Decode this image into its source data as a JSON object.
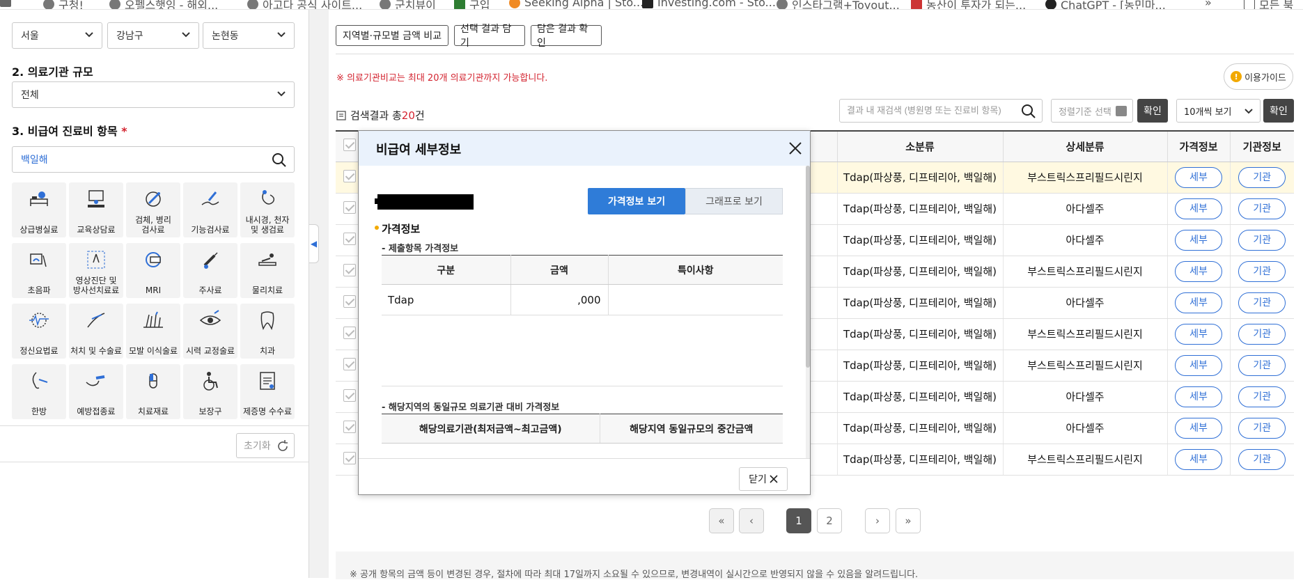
{
  "bookmarks": [
    {
      "label": "구청!",
      "icon": "globe-icon"
    },
    {
      "label": "오펠스햇잉 - 해외...",
      "icon": "globe-icon"
    },
    {
      "label": "아고다 공식 사이트...",
      "icon": "globe-icon"
    },
    {
      "label": "군치뷰이",
      "icon": "globe-icon"
    },
    {
      "label": "구입",
      "icon": "user-icon"
    },
    {
      "label": "Seeking Alpha | Sto...",
      "icon": "alpha-icon"
    },
    {
      "label": "Investing.com - Sto...",
      "icon": "inv-icon"
    },
    {
      "label": "인스타그램+Toyout...",
      "icon": "globe-icon"
    },
    {
      "label": "농산이 투자가 되는...",
      "icon": "doc-icon"
    },
    {
      "label": "ChatGPT - [농민마...",
      "icon": "chatgpt-icon"
    },
    {
      "label": "»",
      "icon": ""
    },
    {
      "label": "모든 북",
      "icon": "folder-icon"
    }
  ],
  "filters": {
    "region1": "서울",
    "region2": "강남구",
    "region3": "논현동",
    "size_title": "2. 의료기관 규모",
    "size_value": "전체",
    "item_title": "3. 비급여 진료비 항목",
    "item_required": "*",
    "search_placeholder": "백일해",
    "reset_label": "초기화"
  },
  "categories": [
    {
      "label": "상급병실료",
      "icon": "hospital-bed-icon"
    },
    {
      "label": "교육상담료",
      "icon": "counseling-icon"
    },
    {
      "label": "검체, 병리\n검사료",
      "icon": "microscope-icon"
    },
    {
      "label": "기능검사료",
      "icon": "function-test-icon"
    },
    {
      "label": "내시경, 천자\n및 생검료",
      "icon": "endoscope-icon"
    },
    {
      "label": "초음파",
      "icon": "ultrasound-icon"
    },
    {
      "label": "영상진단 및\n방사선치료료",
      "icon": "radiation-icon"
    },
    {
      "label": "MRI",
      "icon": "mri-icon"
    },
    {
      "label": "주사료",
      "icon": "syringe-icon"
    },
    {
      "label": "물리치료",
      "icon": "physical-therapy-icon"
    },
    {
      "label": "정신요법료",
      "icon": "brain-icon"
    },
    {
      "label": "처치 및 수술료",
      "icon": "surgery-icon"
    },
    {
      "label": "모발 이식술료",
      "icon": "hair-icon"
    },
    {
      "label": "시력 교정술료",
      "icon": "eye-icon"
    },
    {
      "label": "치과",
      "icon": "tooth-icon"
    },
    {
      "label": "한방",
      "icon": "acupuncture-icon"
    },
    {
      "label": "예방접종료",
      "icon": "vaccine-icon"
    },
    {
      "label": "치료재료",
      "icon": "capsule-icon"
    },
    {
      "label": "보장구",
      "icon": "wheelchair-icon"
    },
    {
      "label": "제증명 수수료",
      "icon": "certificate-icon"
    }
  ],
  "main": {
    "btn_compare": "지역별·규모별 금액 비교",
    "btn_save": "선택 결과 담기",
    "btn_check": "담은 결과 확인",
    "notice": "※ 의료기관비교는 최대 20개 의료기관까지 가능합니다.",
    "guide": "이용가이드",
    "result_prefix": "검색결과 총",
    "result_count": "20",
    "result_suffix": "건",
    "re_search_placeholder": "결과 내 재검색 (병원명 또는 진료비 항목)",
    "sort_label": "정렬기준 선택",
    "confirm": "확인",
    "per_page": "10개씩 보기",
    "footer_note": "※ 공개 항목의 금액 등이 변경된 경우, 절차에 따라 최대 17일까지 소요될 수 있으므로, 변경내역이 실시간으로 반영되지 않을 수 있음을 알려드립니다."
  },
  "table": {
    "headers": {
      "sub": "소분류",
      "detail": "상세분류",
      "price": "가격정보",
      "org": "기관정보"
    },
    "price_btn": "세부",
    "org_btn": "기관",
    "rows": [
      {
        "sub": "Tdap(파상풍, 디프테리아, 백일해)",
        "detail": "부스트릭스프리필드시린지"
      },
      {
        "sub": "Tdap(파상풍, 디프테리아, 백일해)",
        "detail": "아다셀주"
      },
      {
        "sub": "Tdap(파상풍, 디프테리아, 백일해)",
        "detail": "아다셀주"
      },
      {
        "sub": "Tdap(파상풍, 디프테리아, 백일해)",
        "detail": "부스트릭스프리필드시린지"
      },
      {
        "sub": "Tdap(파상풍, 디프테리아, 백일해)",
        "detail": "아다셀주"
      },
      {
        "sub": "Tdap(파상풍, 디프테리아, 백일해)",
        "detail": "부스트릭스프리필드시린지"
      },
      {
        "sub": "Tdap(파상풍, 디프테리아, 백일해)",
        "detail": "부스트릭스프리필드시린지"
      },
      {
        "sub": "Tdap(파상풍, 디프테리아, 백일해)",
        "detail": "아다셀주"
      },
      {
        "sub": "Tdap(파상풍, 디프테리아, 백일해)",
        "detail": "아다셀주"
      },
      {
        "sub": "Tdap(파상풍, 디프테리아, 백일해)",
        "detail": "부스트릭스프리필드시린지"
      }
    ]
  },
  "pagination": {
    "first": "«",
    "prev": "‹",
    "pages": [
      "1",
      "2"
    ],
    "active": "1",
    "next": "›",
    "last": "»"
  },
  "modal": {
    "title": "비급여 세부정보",
    "tab_price": "가격정보 보기",
    "tab_graph": "그래프로 보기",
    "section": "가격정보",
    "caption1": "- 제출항목 가격정보",
    "col_div": "구분",
    "col_amount": "금액",
    "col_note": "특이사항",
    "row_div": "Tdap",
    "row_amount": ",000",
    "row_note": "",
    "caption2": "- 해당지역의 동일규모 의료기관 대비 가격정보",
    "col_range": "해당의료기관(최저금액~최고금액)",
    "col_median": "해당지역 동일규모의 중간금액",
    "close": "닫기"
  },
  "colors": {
    "accent": "#2f7cd8",
    "required": "#d3232f",
    "selected_row": "#fff9e1"
  }
}
